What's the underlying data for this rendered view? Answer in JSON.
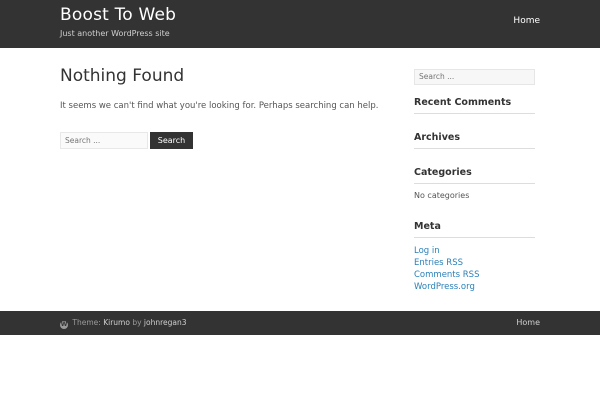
{
  "header": {
    "site_title": "Boost To Web",
    "tagline": "Just another WordPress site",
    "nav_home": "Home"
  },
  "main": {
    "title": "Nothing Found",
    "message": "It seems we can't find what you're looking for. Perhaps searching can help.",
    "search_placeholder": "Search ...",
    "search_button": "Search"
  },
  "sidebar": {
    "search_placeholder": "Search ...",
    "recent_comments_title": "Recent Comments",
    "archives_title": "Archives",
    "categories_title": "Categories",
    "categories_empty": "No categories",
    "meta_title": "Meta",
    "meta_links": [
      "Log in",
      "Entries RSS",
      "Comments RSS",
      "WordPress.org"
    ]
  },
  "footer": {
    "theme_prefix": "Theme:",
    "theme_name": "Kirumo",
    "by_text": "by",
    "author": "johnregan3",
    "home": "Home",
    "wp_icon": "wordpress-icon"
  },
  "colors": {
    "header_bg": "#333333",
    "link": "#2a80b9"
  }
}
